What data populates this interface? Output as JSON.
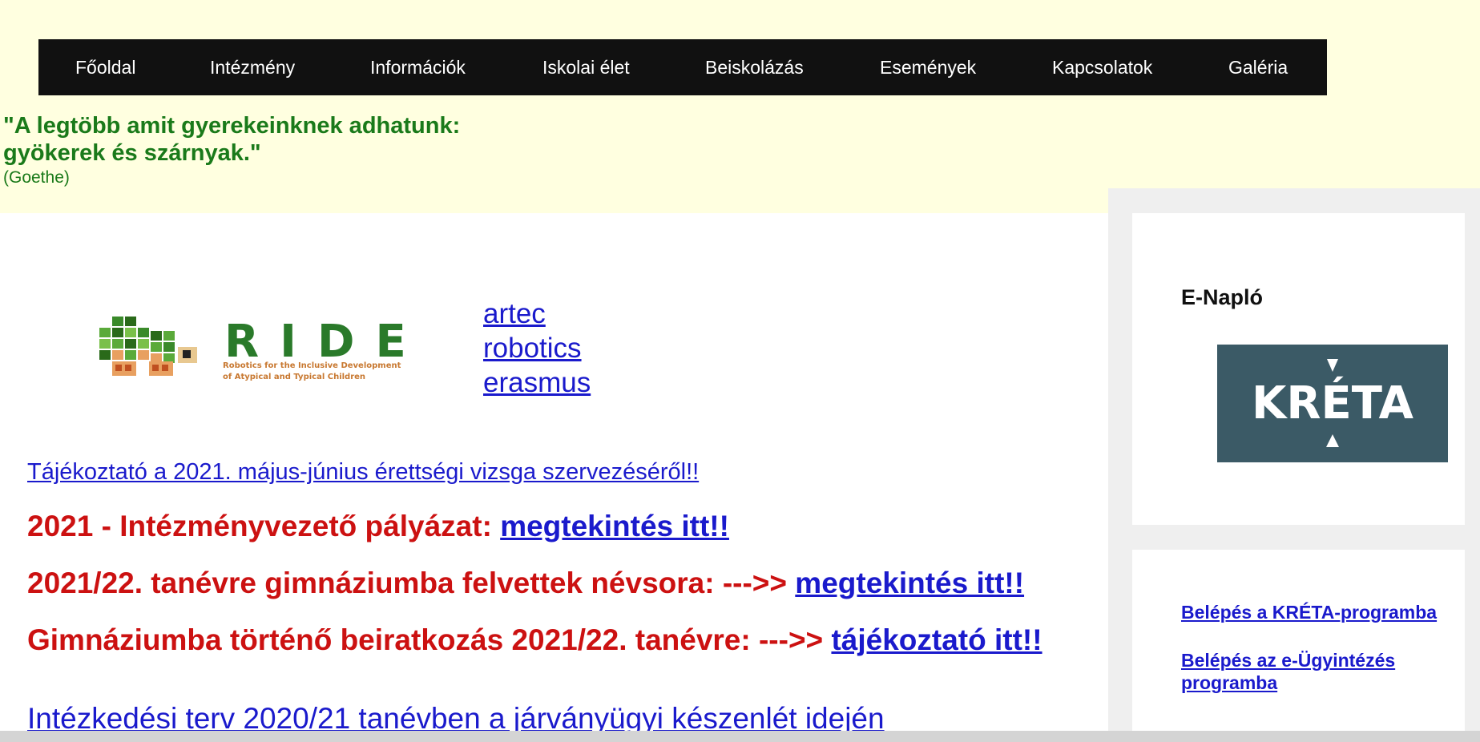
{
  "nav": {
    "items": [
      "Főoldal",
      "Intézmény",
      "Információk",
      "Iskolai élet",
      "Beiskolázás",
      "Események",
      "Kapcsolatok",
      "Galéria"
    ]
  },
  "quote": {
    "line1": "\"A legtöbb amit gyerekeinknek adhatunk:",
    "line2": "gyökerek és szárnyak.\"",
    "author": "(Goethe)"
  },
  "ride_logo": {
    "wordmark": "RIDE",
    "tagline1": "Robotics for the Inclusive Development",
    "tagline2": "of Atypical and Typical Children"
  },
  "erasmus_links": [
    "artec",
    "robotics",
    "erasmus"
  ],
  "notice_link": "Tájékoztató a 2021. május-június érettségi vizsga szervezéséről!!",
  "announcements": [
    {
      "text": "2021 - Intézményvezető pályázat: ",
      "link": "megtekintés itt!!"
    },
    {
      "text": "2021/22. tanévre gimnáziumba felvettek névsora: --->> ",
      "link": "megtekintés itt!!"
    },
    {
      "text": "Gimnáziumba történő beiratkozás 2021/22. tanévre: --->> ",
      "link": "tájékoztató itt!!"
    }
  ],
  "plan_link": "Intézkedési terv 2020/21 tanévben a járványügyi készenlét idején",
  "sidebar": {
    "enaplo_title": "E-Napló",
    "kreta_logo_text": "KRÉTA",
    "kreta_login": "Belépés a KRÉTA-programba",
    "eugy_login": "Belépés az e-Ügyintézés programba"
  },
  "colors": {
    "page_bg": "#ffffe0",
    "nav_bg": "#111111",
    "quote_green": "#1a7a1a",
    "alert_red": "#cc1111",
    "link_blue": "#1a1acc",
    "kreta_bg": "#3b5a66"
  }
}
